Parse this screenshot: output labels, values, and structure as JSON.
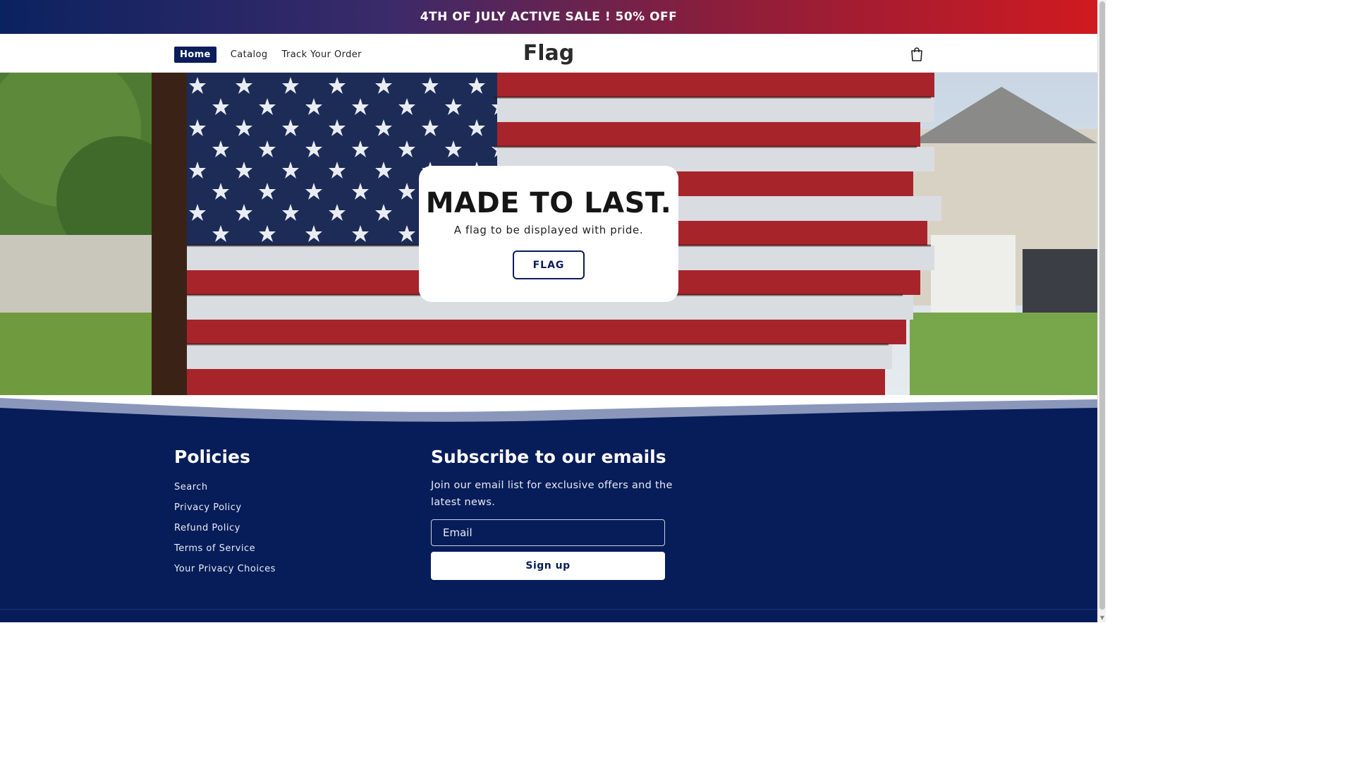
{
  "announcement": {
    "text": "4TH OF JULY ACTIVE SALE ! 50% OFF"
  },
  "header": {
    "nav": [
      {
        "label": "Home",
        "active": true
      },
      {
        "label": "Catalog",
        "active": false
      },
      {
        "label": "Track Your Order",
        "active": false
      }
    ],
    "logo": "Flag",
    "cart_icon": "shopping-bag-icon"
  },
  "hero": {
    "title": "MADE TO LAST.",
    "subtitle": "A flag to be displayed with pride.",
    "button_label": "FLAG"
  },
  "footer": {
    "policies_title": "Policies",
    "policy_links": [
      "Search",
      "Privacy Policy",
      "Refund Policy",
      "Terms of Service",
      "Your Privacy Choices"
    ],
    "subscribe_title": "Subscribe to our emails",
    "subscribe_text": "Join our email list for exclusive offers and the latest news.",
    "email_placeholder": "Email",
    "signup_label": "Sign up"
  },
  "colors": {
    "navy": "#071d59",
    "red": "#d01a1f",
    "white": "#ffffff"
  }
}
